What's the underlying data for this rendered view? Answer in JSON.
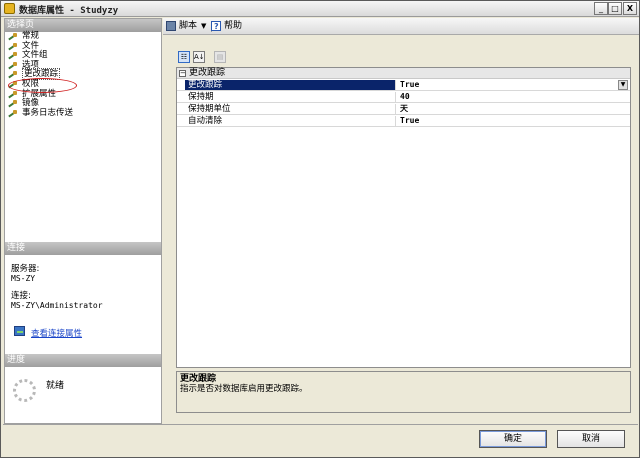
{
  "window": {
    "title": "数据库属性 - Studyzy"
  },
  "titlebar": {
    "minimize": "_",
    "maximize": "□",
    "close": "X"
  },
  "left_pane": {
    "pages_header": "选择页",
    "pages": [
      {
        "label": "常规"
      },
      {
        "label": "文件"
      },
      {
        "label": "文件组"
      },
      {
        "label": "选项"
      },
      {
        "label": "更改跟踪",
        "selected": true
      },
      {
        "label": "权限"
      },
      {
        "label": "扩展属性"
      },
      {
        "label": "镜像"
      },
      {
        "label": "事务日志传送"
      }
    ],
    "connection_header": "连接",
    "server_label": "服务器:",
    "server_value": "MS-ZY",
    "connection_label": "连接:",
    "connection_value": "MS-ZY\\Administrator",
    "view_connection_link": "查看连接属性",
    "progress_header": "进度",
    "progress_status": "就绪"
  },
  "toolbar": {
    "script_label": "脚本",
    "help_label": "帮助"
  },
  "grid_tools": {
    "categorized": "☷",
    "alphabetical": "A↓",
    "pages": "▤"
  },
  "property_grid": {
    "category": "更改跟踪",
    "category_toggle": "−",
    "dropdown_arrow": "▼",
    "rows": [
      {
        "name": "更改跟踪",
        "value": "True",
        "selected": true
      },
      {
        "name": "保持期",
        "value": "40"
      },
      {
        "name": "保持期单位",
        "value": "天"
      },
      {
        "name": "自动清除",
        "value": "True"
      }
    ]
  },
  "description": {
    "title": "更改跟踪",
    "text": "指示是否对数据库启用更改跟踪。"
  },
  "buttons": {
    "ok": "确定",
    "cancel": "取消"
  }
}
